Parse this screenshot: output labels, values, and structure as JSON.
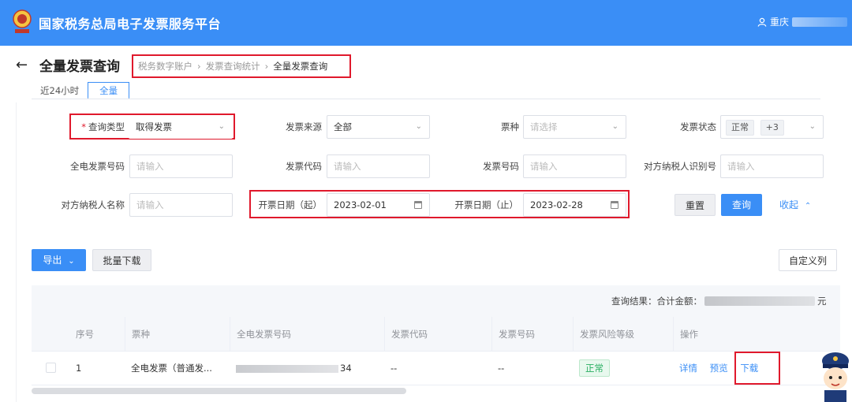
{
  "header": {
    "app_title": "国家税务总局电子发票服务平台",
    "user_name": "重庆"
  },
  "page": {
    "title": "全量发票查询",
    "breadcrumb": [
      {
        "label": "税务数字账户"
      },
      {
        "label": "发票查询统计"
      },
      {
        "label": "全量发票查询"
      }
    ]
  },
  "time_tabs": [
    {
      "label": "近24小时",
      "active": false
    },
    {
      "label": "全量",
      "active": true
    }
  ],
  "filters": {
    "query_type": {
      "label": "查询类型",
      "required": true,
      "value": "取得发票"
    },
    "invoice_source": {
      "label": "发票来源",
      "value": "全部"
    },
    "invoice_kind": {
      "label": "票种",
      "placeholder": "请选择"
    },
    "invoice_status": {
      "label": "发票状态",
      "tags": [
        "正常",
        "+3"
      ]
    },
    "full_invoice_no": {
      "label": "全电发票号码",
      "placeholder": "请输入"
    },
    "invoice_code": {
      "label": "发票代码",
      "placeholder": "请输入"
    },
    "invoice_no": {
      "label": "发票号码",
      "placeholder": "请输入"
    },
    "counterparty_tax_id": {
      "label": "对方纳税人识别号",
      "placeholder": "请输入"
    },
    "counterparty_name": {
      "label": "对方纳税人名称",
      "placeholder": "请输入"
    },
    "date_start": {
      "label": "开票日期（起）",
      "value": "2023-02-01"
    },
    "date_end": {
      "label": "开票日期（止）",
      "value": "2023-02-28"
    }
  },
  "actions": {
    "reset": "重置",
    "search": "查询",
    "collapse": "收起",
    "export": "导出",
    "batch_download": "批量下载",
    "custom_columns": "自定义列"
  },
  "result": {
    "prefix": "查询结果：合计金额：",
    "suffix": "元"
  },
  "table": {
    "columns": [
      "序号",
      "票种",
      "全电发票号码",
      "发票代码",
      "发票号码",
      "发票风险等级",
      "操作"
    ],
    "rows": [
      {
        "index": "1",
        "kind": "全电发票（普通发...",
        "full_no_tail": "34",
        "code": "--",
        "number": "--",
        "risk": "正常",
        "ops": [
          "详情",
          "预览",
          "下载"
        ]
      }
    ]
  },
  "colors": {
    "primary": "#3a8ef6",
    "highlight_red": "#e0192c",
    "success": "#27ae60"
  },
  "icons": {
    "back": "arrow-left-icon",
    "user": "user-icon",
    "dropdown": "chevron-down-icon",
    "calendar": "calendar-icon",
    "collapse": "chevron-up-icon"
  }
}
